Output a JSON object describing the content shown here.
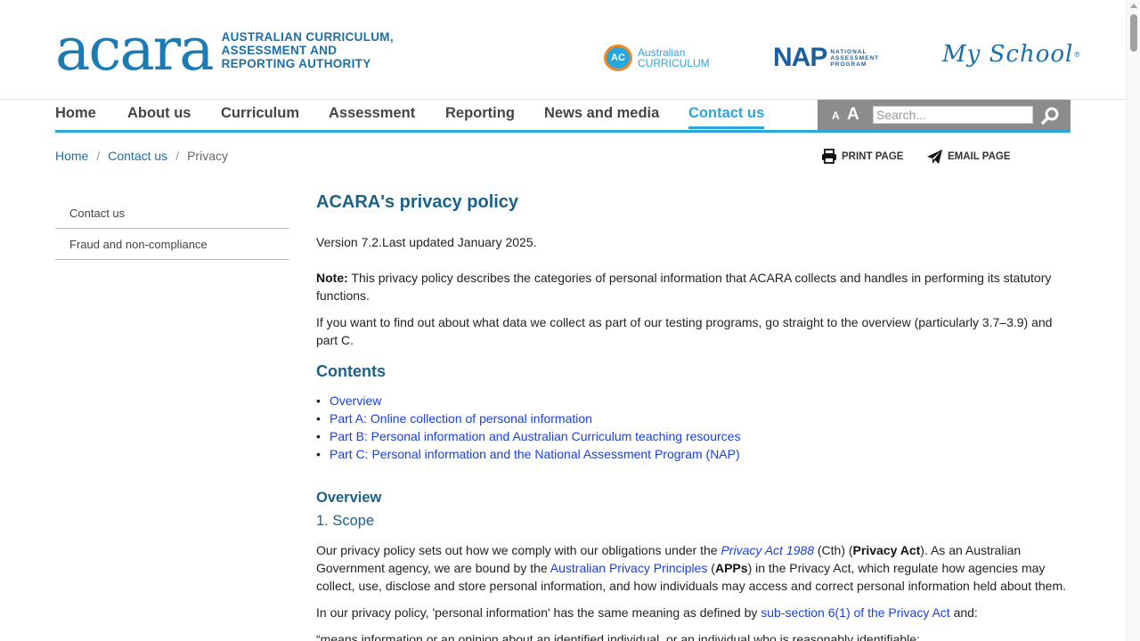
{
  "header": {
    "logo_mark": "acara",
    "logo_text": [
      "AUSTRALIAN CURRICULUM,",
      "ASSESSMENT AND",
      "REPORTING AUTHORITY"
    ],
    "partners": {
      "ac_badge": "AC",
      "ac_text": [
        "Australian",
        "CURRICULUM"
      ],
      "nap_big": "NAP",
      "nap_small": [
        "NATIONAL",
        "ASSESSMENT",
        "PROGRAM"
      ],
      "myschool": "My School",
      "myschool_mark": "®"
    }
  },
  "nav": {
    "items": [
      "Home",
      "About us",
      "Curriculum",
      "Assessment",
      "Reporting",
      "News and media",
      "Contact us"
    ],
    "active": "Contact us",
    "font_small": "A",
    "font_large": "A",
    "search_placeholder": "Search..."
  },
  "breadcrumb": [
    "Home",
    "Contact us",
    "Privacy"
  ],
  "tools": {
    "print": "PRINT PAGE",
    "email": "EMAIL PAGE"
  },
  "sidebar": [
    "Contact us",
    "Fraud and non-compliance"
  ],
  "content": {
    "title": "ACARA's privacy policy",
    "version": "Version 7.2.Last updated January 2025.",
    "note_label": "Note:",
    "note_text": " This privacy policy describes the categories of personal information that ACARA collects and handles in performing its statutory functions.",
    "intro": "If you want to find out about what data we collect as part of our testing programs, go straight to the overview (particularly 3.7–3.9) and part C.",
    "contents_heading": "Contents",
    "contents": [
      "Overview",
      "Part A: Online collection of personal information",
      "Part B: Personal information and Australian Curriculum teaching resources",
      "Part C: Personal information and the National Assessment Program (NAP)"
    ],
    "overview_heading": "Overview",
    "scope_heading": "1. Scope",
    "p1": {
      "a": "Our privacy policy sets out how we comply with our obligations under the ",
      "link1": "Privacy Act 1988",
      "b": " (Cth) (",
      "bold1": "Privacy Act",
      "c": "). As an Australian Government agency, we are bound by the ",
      "link2": "Australian Privacy Principles",
      "d": " (",
      "bold2": "APPs",
      "e": ") in the Privacy Act, which regulate how agencies may collect, use, disclose and store personal information, and how individuals may access and correct personal information held about them."
    },
    "p2": {
      "a": "In our privacy policy, 'personal information' has the same meaning as defined by ",
      "link": "sub-section 6(1) of the Privacy Act",
      "b": " and:"
    },
    "p3": "“means information or an opinion about an identified individual, or an individual who is reasonably identifiable:"
  }
}
